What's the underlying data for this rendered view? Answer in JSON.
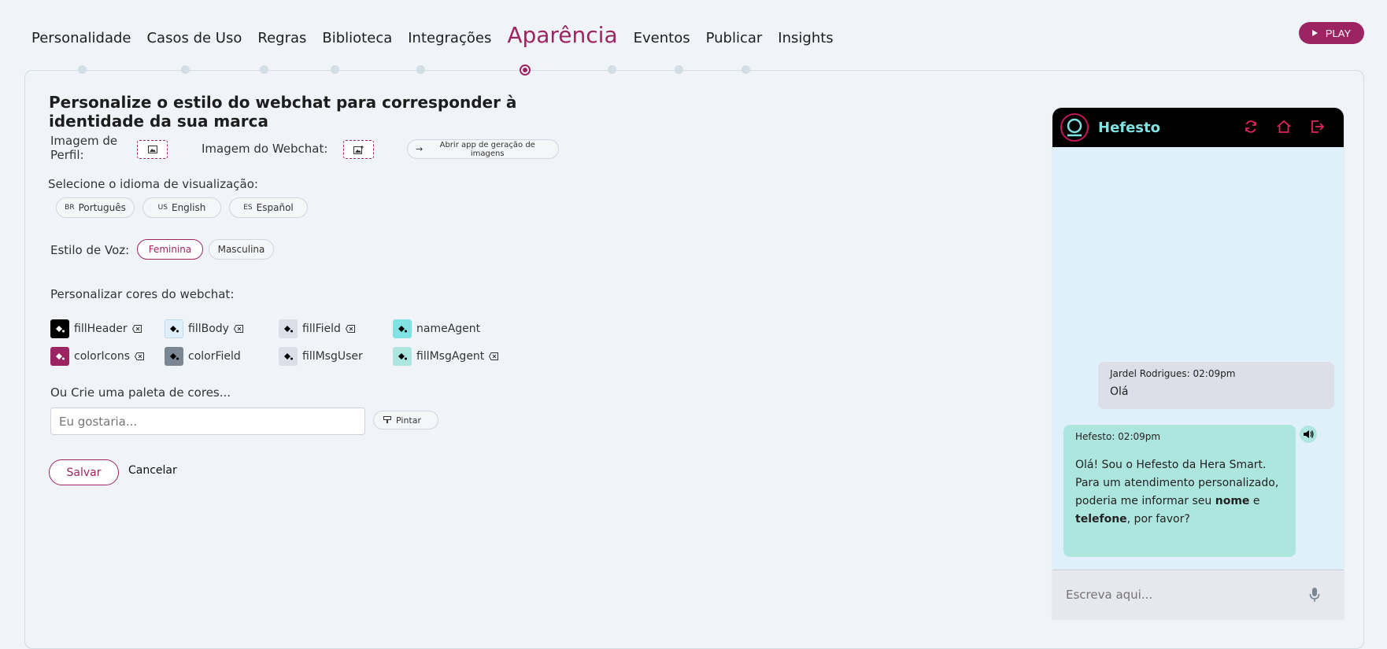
{
  "nav": {
    "items": [
      "Personalidade",
      "Casos de Uso",
      "Regras",
      "Biblioteca",
      "Integrações",
      "Aparência",
      "Eventos",
      "Publicar",
      "Insights"
    ],
    "active_index": 5,
    "play_label": "PLAY"
  },
  "form": {
    "title": "Personalize o estilo do webchat para corresponder à identidade da sua marca",
    "profile_image_label": "Imagem de Perfil:",
    "webchat_image_label": "Imagem do Webchat:",
    "open_app_label": "Abrir app de geração de imagens",
    "language_label": "Selecione o idioma de visualização:",
    "languages": [
      {
        "code": "BR",
        "label": "Português"
      },
      {
        "code": "US",
        "label": "English"
      },
      {
        "code": "ES",
        "label": "Español"
      }
    ],
    "voice_label": "Estilo de Voz:",
    "voice_options": [
      "Feminina",
      "Masculina"
    ],
    "voice_selected": "Feminina",
    "colors_label": "Personalizar cores do webchat:",
    "colors": [
      {
        "name": "fillHeader",
        "color": "#000000",
        "icon": "#ffffff",
        "clearable": true
      },
      {
        "name": "fillBody",
        "color": "#e0f0fb",
        "icon": "#000000",
        "clearable": true
      },
      {
        "name": "fillField",
        "color": "#dcdfe8",
        "icon": "#000000",
        "clearable": true
      },
      {
        "name": "nameAgent",
        "color": "#7fe3e3",
        "icon": "#000000",
        "clearable": false
      },
      {
        "name": "colorIcons",
        "color": "#9c2462",
        "icon": "#ffffff",
        "clearable": true
      },
      {
        "name": "colorField",
        "color": "#7a8792",
        "icon": "#ffffff",
        "clearable": false
      },
      {
        "name": "fillMsgUser",
        "color": "#dcdfe8",
        "icon": "#000000",
        "clearable": false
      },
      {
        "name": "fillMsgAgent",
        "color": "#ade6de",
        "icon": "#000000",
        "clearable": true
      }
    ],
    "palette_label": "Ou Crie uma paleta de cores...",
    "palette_placeholder": "Eu gostaria...",
    "paint_label": "Pintar",
    "save_label": "Salvar",
    "cancel_label": "Cancelar"
  },
  "chat": {
    "brand": "Hefesto",
    "user_msg": {
      "who": "Jardel Rodrigues: 02:09pm",
      "text": "Olá"
    },
    "agent_msg": {
      "who": "Hefesto: 02:09pm",
      "text_1": "Olá! Sou o Hefesto da Hera Smart. Para um atendimento personalizado, poderia me informar seu ",
      "bold_1": "nome",
      "text_2": " e ",
      "bold_2": "telefone",
      "text_3": ", por favor?"
    },
    "input_placeholder": "Escreva aqui..."
  },
  "theme": {
    "accent": "#9c2462",
    "brand_name_color": "#7fe3e3"
  }
}
